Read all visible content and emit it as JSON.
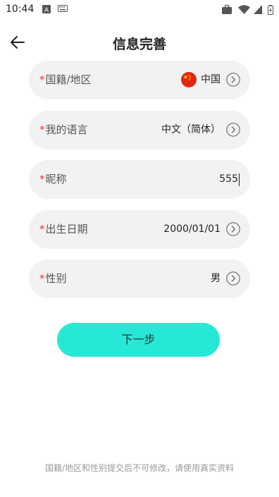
{
  "status_bar": {
    "time": "10:44"
  },
  "header": {
    "title": "信息完善"
  },
  "form": {
    "required_mark": "*",
    "fields": [
      {
        "label": "国籍/地区",
        "value": "中国"
      },
      {
        "label": "我的语言",
        "value": "中文（简体）"
      },
      {
        "label": "昵称",
        "value": "555"
      },
      {
        "label": "出生日期",
        "value": "2000/01/01"
      },
      {
        "label": "性别",
        "value": "男"
      }
    ]
  },
  "actions": {
    "next_label": "下一步"
  },
  "footer": {
    "notice": "国籍/地区和性别提交后不可修改，请使用真实资料"
  },
  "colors": {
    "accent": "#27e8d6",
    "required": "#e33333",
    "field_bg": "#f2f2f2"
  },
  "icons": [
    "back-arrow-icon",
    "chevron-right-circle-icon",
    "china-flag-icon",
    "wifi-icon",
    "signal-icon",
    "battery-icon"
  ]
}
